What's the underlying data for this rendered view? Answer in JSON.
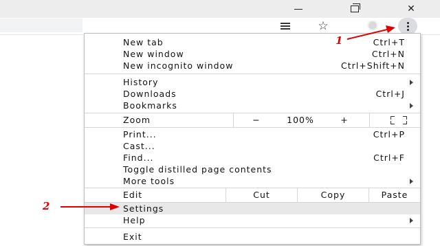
{
  "menu": {
    "new_tab": {
      "label": "New tab",
      "shortcut": "Ctrl+T"
    },
    "new_window": {
      "label": "New window",
      "shortcut": "Ctrl+N"
    },
    "new_incognito": {
      "label": "New incognito window",
      "shortcut": "Ctrl+Shift+N"
    },
    "history": {
      "label": "History"
    },
    "downloads": {
      "label": "Downloads",
      "shortcut": "Ctrl+J"
    },
    "bookmarks": {
      "label": "Bookmarks"
    },
    "zoom": {
      "label": "Zoom",
      "minus": "−",
      "value": "100%",
      "plus": "+"
    },
    "print": {
      "label": "Print...",
      "shortcut": "Ctrl+P"
    },
    "cast": {
      "label": "Cast..."
    },
    "find": {
      "label": "Find...",
      "shortcut": "Ctrl+F"
    },
    "toggle_distilled": {
      "label": "Toggle distilled page contents"
    },
    "more_tools": {
      "label": "More tools"
    },
    "edit": {
      "label": "Edit",
      "cut": "Cut",
      "copy": "Copy",
      "paste": "Paste"
    },
    "settings": {
      "label": "Settings"
    },
    "help": {
      "label": "Help"
    },
    "exit": {
      "label": "Exit"
    }
  },
  "annotations": {
    "step1": "1",
    "step2": "2",
    "color": "#e00000"
  },
  "icons": {
    "window_controls": [
      "minimize-icon",
      "restore-icon",
      "close-icon"
    ],
    "toolbar": [
      "reader-mode-icon",
      "bookmark-star-icon",
      "profile-avatar",
      "more-menu-icon"
    ]
  },
  "colors": {
    "highlight": "#e8e8e8",
    "titlebar": "#ededed",
    "kebab_bg": "#dadce0"
  }
}
